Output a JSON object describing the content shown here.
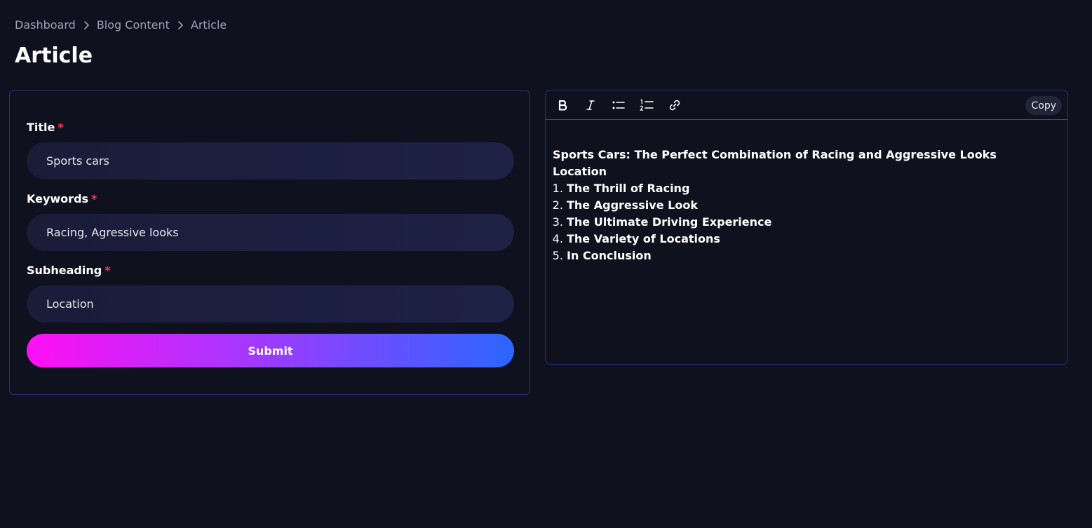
{
  "breadcrumb": {
    "items": [
      "Dashboard",
      "Blog Content",
      "Article"
    ]
  },
  "page_title": "Article",
  "form": {
    "title_label": "Title",
    "title_value": "Sports cars",
    "keywords_label": "Keywords",
    "keywords_value": "Racing, Agressive looks",
    "subheading_label": "Subheading",
    "subheading_value": "Location",
    "required_mark": "*",
    "submit_label": "Submit"
  },
  "editor": {
    "toolbar": {
      "icons": [
        "bold-icon",
        "italic-icon",
        "bullet-list-icon",
        "numbered-list-icon",
        "link-icon"
      ],
      "copy_label": "Copy"
    },
    "heading": "Sports Cars: The Perfect Combination of Racing and Aggressive Looks",
    "subheading": "Location",
    "list": [
      "The Thrill of Racing",
      "The Aggressive Look",
      "The Ultimate Driving Experience",
      "The Variety of Locations",
      "In Conclusion"
    ]
  },
  "colors": {
    "background": "#10111f",
    "border": "#23307a",
    "required": "#ef3d55",
    "gradient_start": "#ff0ff4",
    "gradient_end": "#2b66ff"
  }
}
